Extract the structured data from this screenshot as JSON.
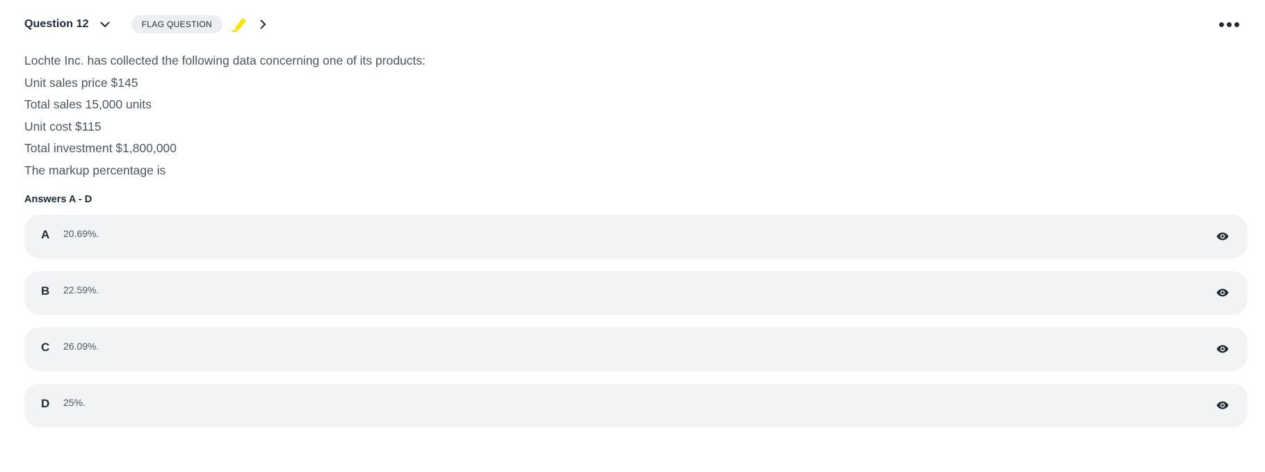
{
  "header": {
    "question_title": "Question 12",
    "flag_label": "FLAG QUESTION",
    "highlight_color": "#f7e600",
    "icons": [
      "chevron-down-icon",
      "highlighter-icon",
      "chevron-right-icon",
      "more-options-icon"
    ]
  },
  "question": {
    "lines": [
      "Lochte Inc. has collected the following data concerning one of its products:",
      "Unit sales price $145",
      "Total sales 15,000 units",
      "Unit cost $115",
      "Total investment $1,800,000",
      "The markup percentage is"
    ]
  },
  "answers_label": "Answers A - D",
  "answers": [
    {
      "letter": "A",
      "text": "20.69%."
    },
    {
      "letter": "B",
      "text": "22.59%."
    },
    {
      "letter": "C",
      "text": "26.09%."
    },
    {
      "letter": "D",
      "text": "25%."
    }
  ],
  "colors": {
    "text_dark": "#1f2a37",
    "text_body": "#4b5563",
    "answer_bg": "#f2f3f5",
    "flag_bg": "#eceef1"
  }
}
